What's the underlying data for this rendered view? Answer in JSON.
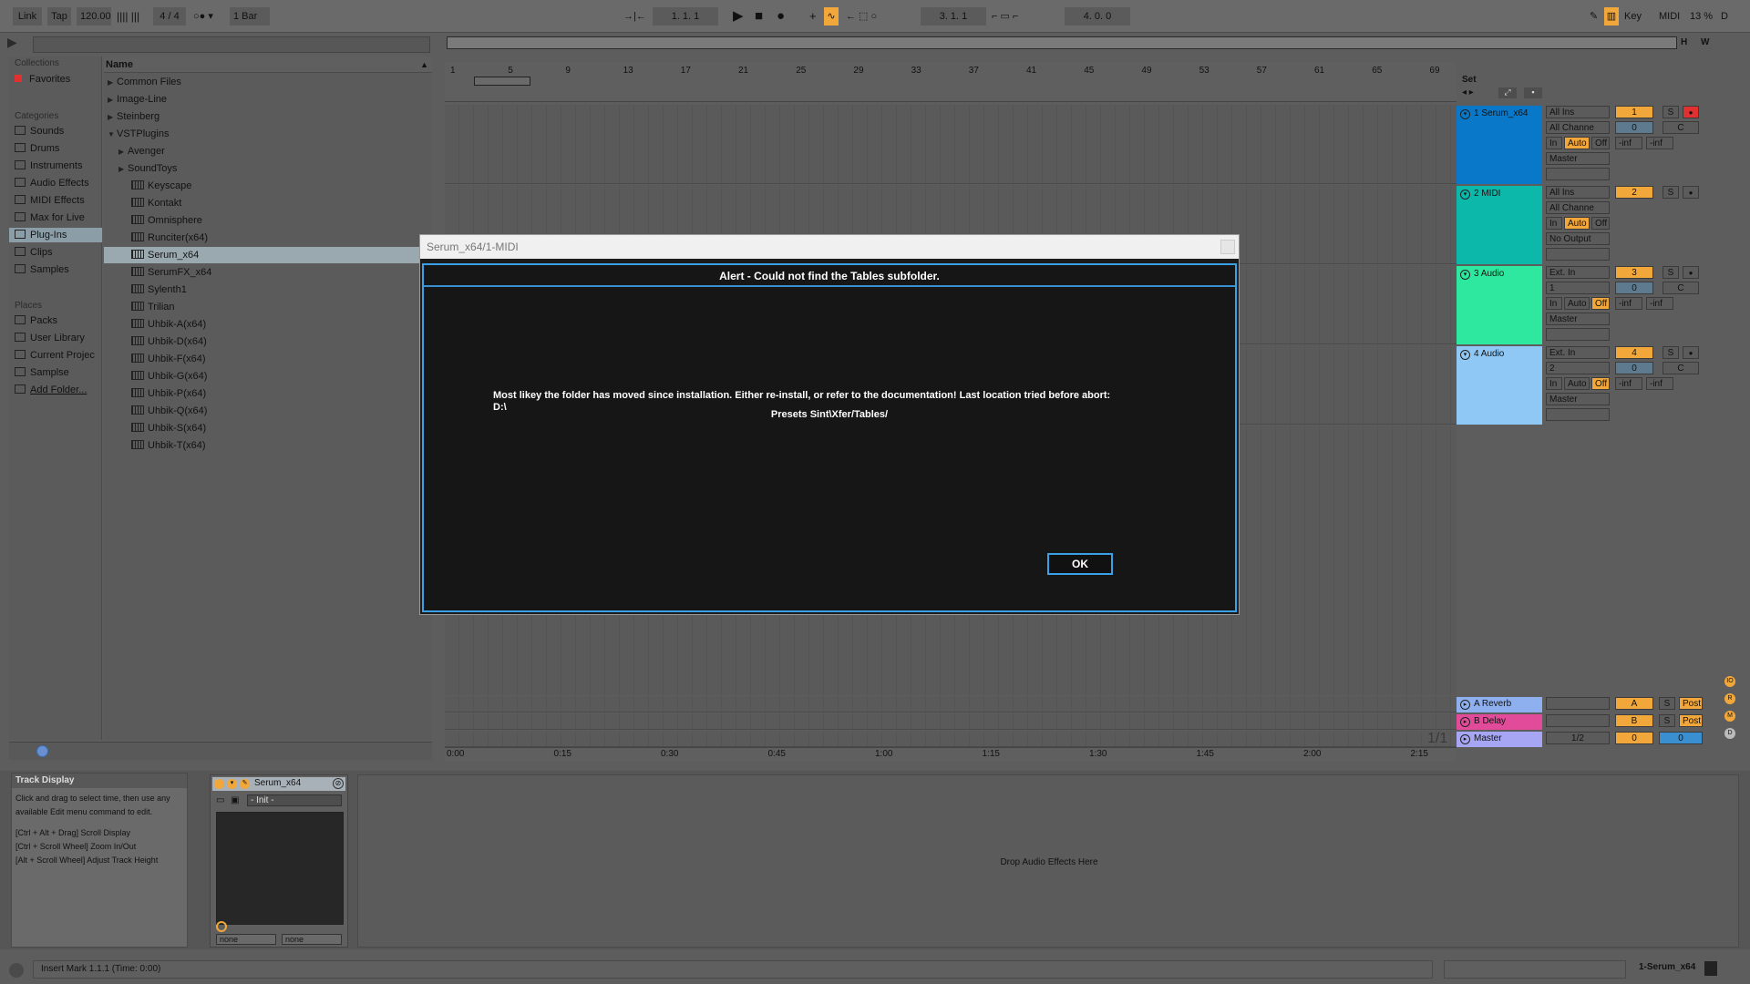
{
  "topbar": {
    "link": "Link",
    "tap": "Tap",
    "tempo": "120.00",
    "time_sig": "4 / 4",
    "quantize": "1 Bar",
    "position": "1.  1.  1",
    "loop_start": "3.  1.  1",
    "loop_length": "4.  0.  0",
    "key": "Key",
    "midi": "MIDI",
    "cpu": "13 %",
    "d": "D"
  },
  "browser": {
    "collections_header": "Collections",
    "favorites": "Favorites",
    "categories_header": "Categories",
    "categories": [
      "Sounds",
      "Drums",
      "Instruments",
      "Audio Effects",
      "MIDI Effects",
      "Max for Live",
      "Plug-Ins",
      "Clips",
      "Samples"
    ],
    "places_header": "Places",
    "places": [
      "Packs",
      "User Library",
      "Current Projec",
      "Samplse",
      "Add Folder..."
    ],
    "name_header": "Name",
    "folders": [
      "Common Files",
      "Image-Line",
      "Steinberg",
      "VSTPlugins"
    ],
    "subfolders": [
      "Avenger",
      "SoundToys"
    ],
    "plugins": [
      "Keyscape",
      "Kontakt",
      "Omnisphere",
      "Runciter(x64)",
      "Serum_x64",
      "SerumFX_x64",
      "Sylenth1",
      "Trilian",
      "Uhbik-A(x64)",
      "Uhbik-D(x64)",
      "Uhbik-F(x64)",
      "Uhbik-G(x64)",
      "Uhbik-P(x64)",
      "Uhbik-Q(x64)",
      "Uhbik-S(x64)",
      "Uhbik-T(x64)"
    ]
  },
  "arrangement": {
    "bars": [
      "1",
      "5",
      "9",
      "13",
      "17",
      "21",
      "25",
      "29",
      "33",
      "37",
      "41",
      "45",
      "49",
      "53",
      "57",
      "61",
      "65",
      "69"
    ],
    "times": [
      "0:00",
      "0:15",
      "0:30",
      "0:45",
      "1:00",
      "1:15",
      "1:30",
      "1:45",
      "2:00",
      "2:15"
    ],
    "set": "Set",
    "h": "H",
    "w": "W",
    "zoom": "1/1"
  },
  "tracks": [
    {
      "name": "1 Serum_x64",
      "color": "#0a78c8",
      "input": "All Ins",
      "channel": "All Channe",
      "monitor": [
        "In",
        "Auto",
        "Off"
      ],
      "output": "Master",
      "num": "1",
      "vol": "0",
      "pan": "C",
      "s": "S",
      "meters": [
        "-inf",
        "-inf"
      ]
    },
    {
      "name": "2 MIDI",
      "color": "#0bb8aa",
      "input": "All Ins",
      "channel": "All Channe",
      "monitor": [
        "In",
        "Auto",
        "Off"
      ],
      "output": "No Output",
      "num": "2",
      "s": "S"
    },
    {
      "name": "3 Audio",
      "color": "#2ee8a0",
      "input": "Ext. In",
      "channel": "1",
      "monitor": [
        "In",
        "Auto",
        "Off"
      ],
      "output": "Master",
      "num": "3",
      "vol": "0",
      "pan": "C",
      "s": "S",
      "meters": [
        "-inf",
        "-inf"
      ]
    },
    {
      "name": "4 Audio",
      "color": "#8fc8f5",
      "input": "Ext. In",
      "channel": "2",
      "monitor": [
        "In",
        "Auto",
        "Off"
      ],
      "output": "Master",
      "num": "4",
      "vol": "0",
      "pan": "C",
      "s": "S",
      "meters": [
        "-inf",
        "-inf"
      ]
    }
  ],
  "returns": [
    {
      "name": "A Reverb",
      "color": "#8fb0ee",
      "letter": "A",
      "s": "S",
      "post": "Post"
    },
    {
      "name": "B Delay",
      "color": "#e24a9a",
      "letter": "B",
      "s": "S",
      "post": "Post"
    },
    {
      "name": "Master",
      "color": "#a6a6f5",
      "output": "1/2",
      "vol": "0",
      "pan": "0"
    }
  ],
  "info": {
    "title": "Track Display",
    "body": "Click and drag to select time, then use any available Edit menu command to edit.",
    "hint1": "[Ctrl + Alt + Drag] Scroll Display",
    "hint2": "[Ctrl + Scroll Wheel] Zoom In/Out",
    "hint3": "[Alt + Scroll Wheel] Adjust Track Height"
  },
  "device": {
    "name": "Serum_x64",
    "preset": "- Init -",
    "param1": "none",
    "param2": "none",
    "drop_text": "Drop Audio Effects Here"
  },
  "dialog": {
    "window_title": "Serum_x64/1-MIDI",
    "heading": "Alert - Could not find the Tables subfolder.",
    "message_line1": "Most likey the folder has moved since installation.  Either re-install, or refer to the documentation! Last location tried before abort:",
    "message_line2": "D:\\",
    "message_line3": "Presets Sint\\Xfer/Tables/",
    "ok": "OK"
  },
  "status": {
    "text": "Insert Mark 1.1.1 (Time: 0:00)",
    "track": "1-Serum_x64"
  }
}
